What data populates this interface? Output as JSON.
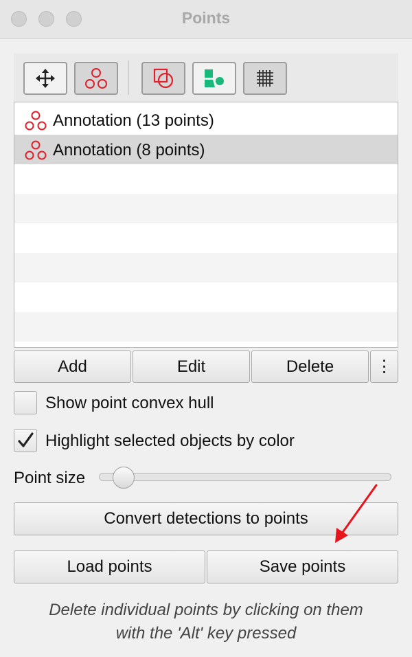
{
  "window": {
    "title": "Points"
  },
  "toolbar": {
    "buttons": [
      {
        "icon": "move-icon",
        "active": false
      },
      {
        "icon": "points-icon",
        "active": true
      },
      {
        "icon": "overlay-shapes-icon",
        "active": true
      },
      {
        "icon": "detections-icon",
        "active": false
      },
      {
        "icon": "grid-icon",
        "active": true
      }
    ]
  },
  "annotations": [
    {
      "label": "Annotation (13 points)",
      "selected": false
    },
    {
      "label": "Annotation (8 points)",
      "selected": true
    }
  ],
  "list_actions": {
    "add": "Add",
    "edit": "Edit",
    "delete": "Delete",
    "more": "⋮"
  },
  "options": {
    "convex_hull": {
      "label": "Show point convex hull",
      "checked": false
    },
    "highlight": {
      "label": "Highlight selected objects by color",
      "checked": true
    }
  },
  "point_size": {
    "label": "Point size",
    "value": 0.05
  },
  "actions": {
    "convert": "Convert detections to points",
    "load": "Load points",
    "save": "Save points"
  },
  "hint": {
    "line1": "Delete individual points by clicking on them",
    "line2": "with the 'Alt' key pressed"
  },
  "colors": {
    "annotation": "#e0202a",
    "detection": "#1ab87a",
    "arrow": "#e8141c"
  }
}
